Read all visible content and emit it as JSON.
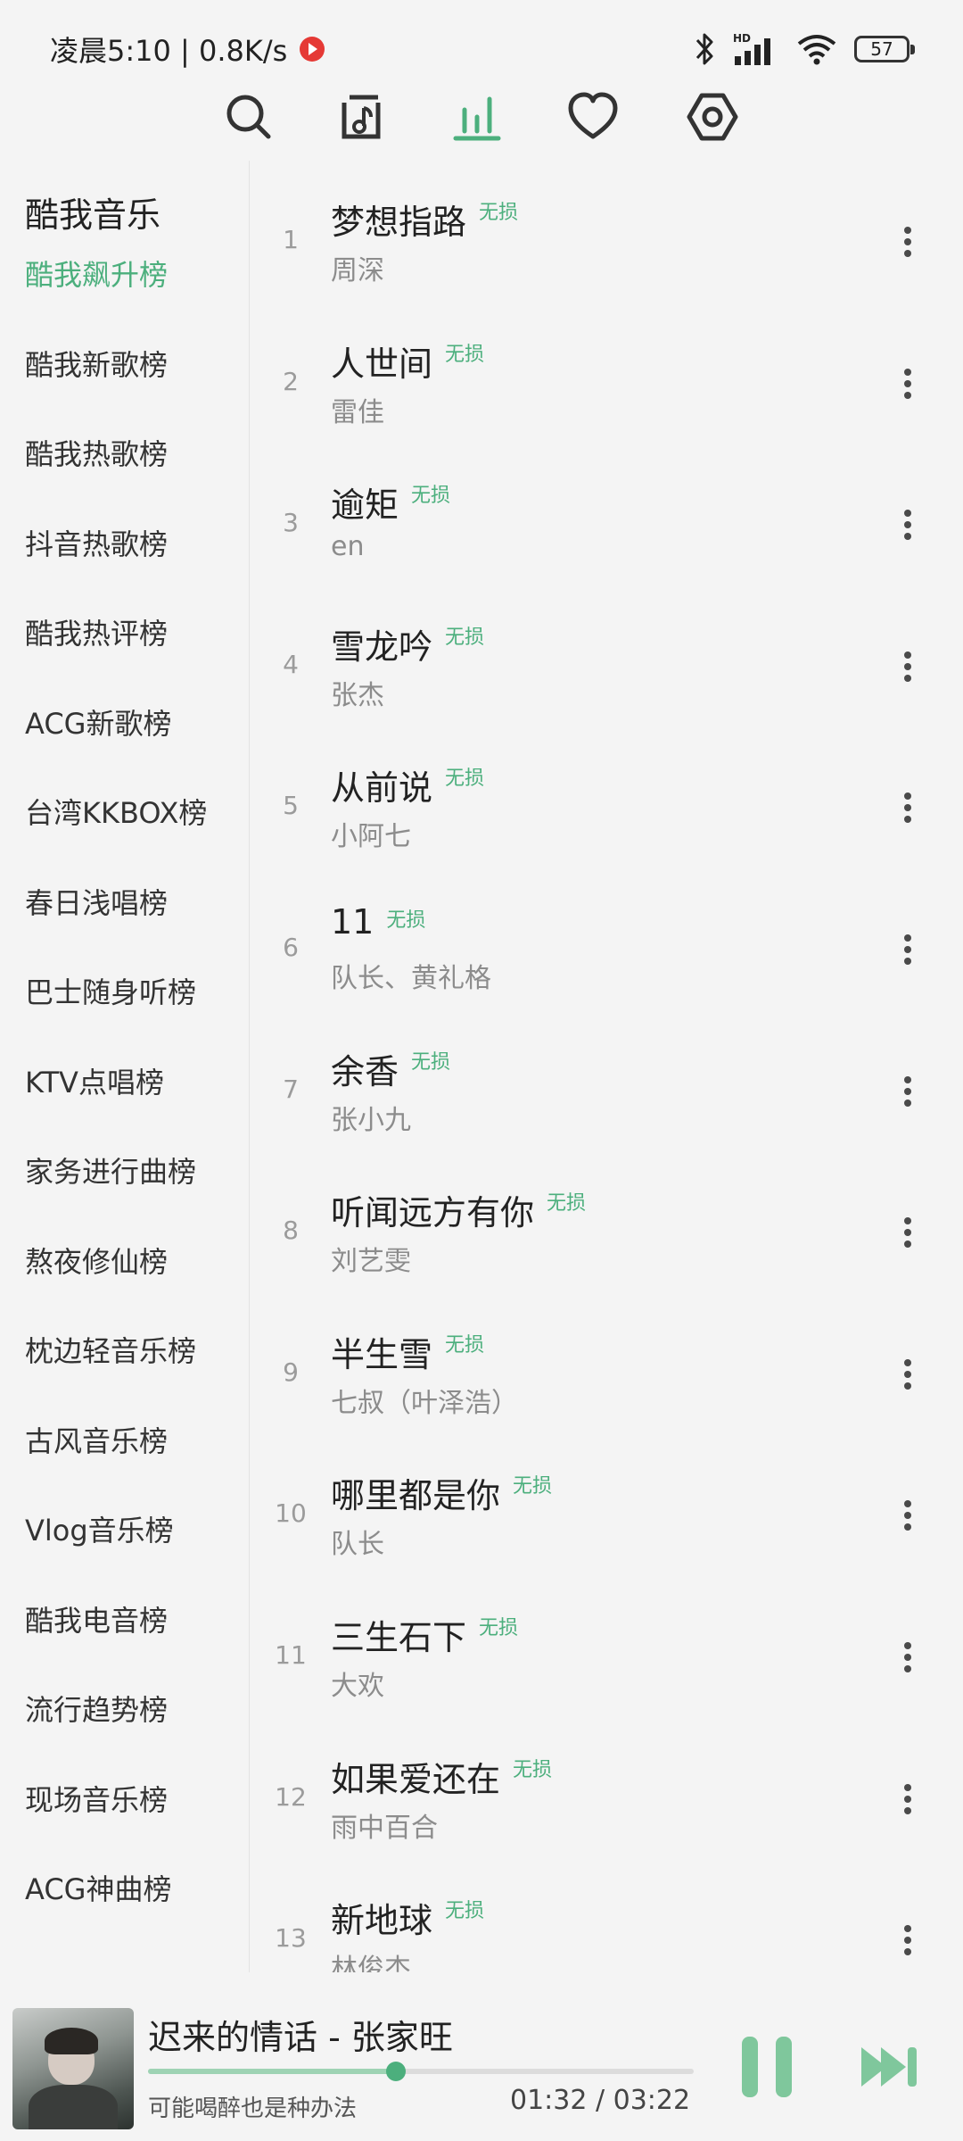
{
  "status_bar": {
    "time_speed": "凌晨5:10 | 0.8K/s",
    "battery": "57"
  },
  "nav": {
    "icons": [
      "search-icon",
      "music-library-icon",
      "charts-icon",
      "favorites-icon",
      "settings-icon"
    ],
    "active": "charts-icon",
    "accent_color": "#4caf7d"
  },
  "sidebar": {
    "title": "酷我音乐",
    "items": [
      {
        "label": "酷我飙升榜",
        "active": true
      },
      {
        "label": "酷我新歌榜"
      },
      {
        "label": "酷我热歌榜"
      },
      {
        "label": "抖音热歌榜"
      },
      {
        "label": "酷我热评榜"
      },
      {
        "label": "ACG新歌榜"
      },
      {
        "label": "台湾KKBOX榜"
      },
      {
        "label": "春日浅唱榜"
      },
      {
        "label": "巴士随身听榜"
      },
      {
        "label": "KTV点唱榜"
      },
      {
        "label": "家务进行曲榜"
      },
      {
        "label": "熬夜修仙榜"
      },
      {
        "label": "枕边轻音乐榜"
      },
      {
        "label": "古风音乐榜"
      },
      {
        "label": "Vlog音乐榜"
      },
      {
        "label": "酷我电音榜"
      },
      {
        "label": "流行趋势榜"
      },
      {
        "label": "现场音乐榜"
      },
      {
        "label": "ACG神曲榜"
      }
    ]
  },
  "songs": [
    {
      "num": "1",
      "title": "梦想指路",
      "badge": "无损",
      "artist": "周深"
    },
    {
      "num": "2",
      "title": "人世间",
      "badge": "无损",
      "artist": "雷佳"
    },
    {
      "num": "3",
      "title": "逾矩",
      "badge": "无损",
      "artist": "en"
    },
    {
      "num": "4",
      "title": "雪龙吟",
      "badge": "无损",
      "artist": "张杰"
    },
    {
      "num": "5",
      "title": "从前说",
      "badge": "无损",
      "artist": "小阿七"
    },
    {
      "num": "6",
      "title": "11",
      "badge": "无损",
      "artist": "队长、黄礼格"
    },
    {
      "num": "7",
      "title": "余香",
      "badge": "无损",
      "artist": "张小九"
    },
    {
      "num": "8",
      "title": "听闻远方有你",
      "badge": "无损",
      "artist": "刘艺雯"
    },
    {
      "num": "9",
      "title": "半生雪",
      "badge": "无损",
      "artist": "七叔（叶泽浩）"
    },
    {
      "num": "10",
      "title": "哪里都是你",
      "badge": "无损",
      "artist": "队长"
    },
    {
      "num": "11",
      "title": "三生石下",
      "badge": "无损",
      "artist": "大欢"
    },
    {
      "num": "12",
      "title": "如果爱还在",
      "badge": "无损",
      "artist": "雨中百合"
    },
    {
      "num": "13",
      "title": "新地球",
      "badge": "无损",
      "artist": "林俊杰"
    }
  ],
  "player": {
    "title": "迟来的情话 - 张家旺",
    "lyric": "可能喝醉也是种办法",
    "time": "01:32 / 03:22",
    "progress": 0.455
  }
}
